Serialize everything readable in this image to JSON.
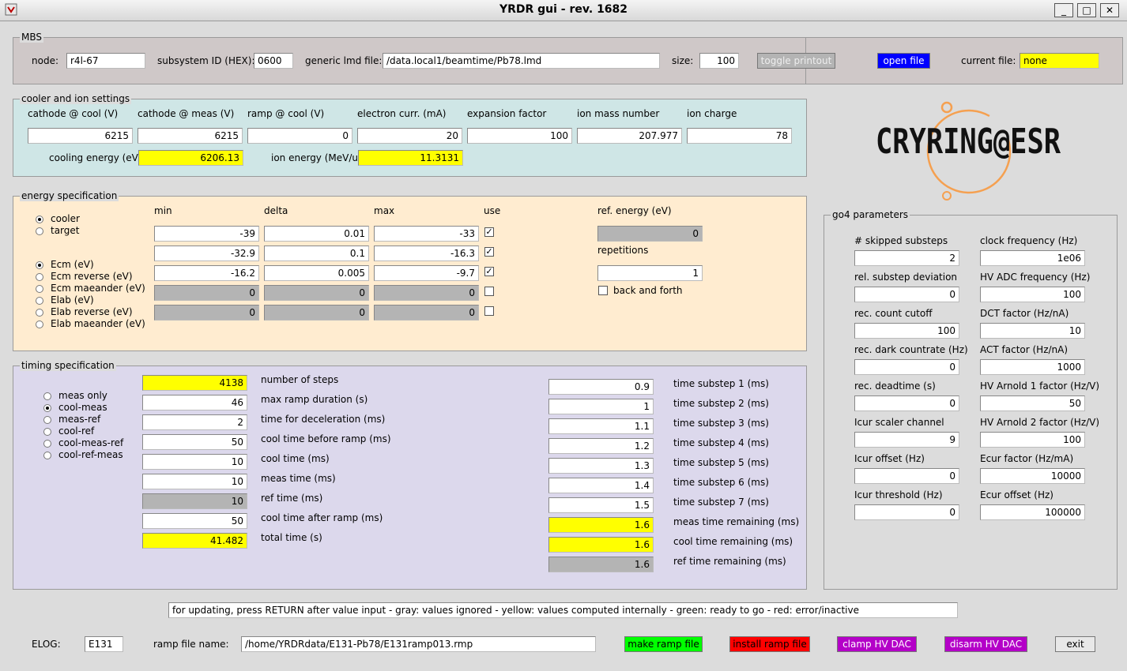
{
  "window": {
    "title": "YRDR gui - rev. 1682",
    "minimize": "_",
    "maximize": "□",
    "close": "✕"
  },
  "mbs": {
    "title": "MBS",
    "node_label": "node:",
    "node": "r4l-67",
    "subsystem_label": "subsystem ID (HEX):",
    "subsystem": "0600",
    "lmd_label": "generic lmd file:",
    "lmd": "/data.local1/beamtime/Pb78.lmd",
    "size_label": "size:",
    "size": "100",
    "toggle_printout": "toggle printout",
    "open_file": "open file",
    "current_file_label": "current file:",
    "current_file": "none"
  },
  "cooler": {
    "title": "cooler and ion  settings",
    "headers": [
      "cathode @ cool (V)",
      "cathode @ meas (V)",
      "ramp @ cool (V)",
      "electron curr. (mA)",
      "expansion factor",
      "ion mass number",
      "ion charge"
    ],
    "values": [
      "6215",
      "6215",
      "0",
      "20",
      "100",
      "207.977",
      "78"
    ],
    "cooling_energy_label": "cooling energy (eV):",
    "cooling_energy": "6206.13",
    "ion_energy_label": "ion energy (MeV/u):",
    "ion_energy": "11.3131"
  },
  "logo": {
    "text": "CRYRING@ESR"
  },
  "energy": {
    "title": "energy specification",
    "col_min": "min",
    "col_delta": "delta",
    "col_max": "max",
    "col_use": "use",
    "mode_radios": [
      {
        "label": "cooler",
        "checked": true
      },
      {
        "label": "target",
        "checked": false
      }
    ],
    "type_radios": [
      {
        "label": "Ecm (eV)",
        "checked": true
      },
      {
        "label": "Ecm reverse (eV)",
        "checked": false
      },
      {
        "label": "Ecm maeander (eV)",
        "checked": false
      },
      {
        "label": "Elab (eV)",
        "checked": false
      },
      {
        "label": "Elab reverse (eV)",
        "checked": false
      },
      {
        "label": "Elab maeander (eV)",
        "checked": false
      }
    ],
    "rows": [
      {
        "min": "-39",
        "delta": "0.01",
        "max": "-33",
        "use": true,
        "disabled": false
      },
      {
        "min": "-32.9",
        "delta": "0.1",
        "max": "-16.3",
        "use": true,
        "disabled": false
      },
      {
        "min": "-16.2",
        "delta": "0.005",
        "max": "-9.7",
        "use": true,
        "disabled": false
      },
      {
        "min": "0",
        "delta": "0",
        "max": "0",
        "use": false,
        "disabled": true
      },
      {
        "min": "0",
        "delta": "0",
        "max": "0",
        "use": false,
        "disabled": true
      }
    ],
    "ref_energy_label": "ref. energy (eV)",
    "ref_energy": "0",
    "repetitions_label": "repetitions",
    "repetitions": "1",
    "back_forth_label": "back and forth"
  },
  "timing": {
    "title": "timing specification",
    "radios": [
      {
        "label": "meas only",
        "checked": false
      },
      {
        "label": "cool-meas",
        "checked": true
      },
      {
        "label": "meas-ref",
        "checked": false
      },
      {
        "label": "cool-ref",
        "checked": false
      },
      {
        "label": "cool-meas-ref",
        "checked": false
      },
      {
        "label": "cool-ref-meas",
        "checked": false
      }
    ],
    "left": [
      {
        "value": "4138",
        "label": "number of steps",
        "style": "yel"
      },
      {
        "value": "46",
        "label": "max ramp duration (s)",
        "style": ""
      },
      {
        "value": "2",
        "label": "time for deceleration (ms)",
        "style": ""
      },
      {
        "value": "50",
        "label": "cool time before ramp (ms)",
        "style": ""
      },
      {
        "value": "10",
        "label": "cool time (ms)",
        "style": ""
      },
      {
        "value": "10",
        "label": "meas time (ms)",
        "style": ""
      },
      {
        "value": "10",
        "label": "ref time (ms)",
        "style": "gry"
      },
      {
        "value": "50",
        "label": "cool time after ramp (ms)",
        "style": ""
      },
      {
        "value": "41.482",
        "label": "total time (s)",
        "style": "yel"
      }
    ],
    "right": [
      {
        "value": "0.9",
        "label": "time substep 1 (ms)",
        "style": ""
      },
      {
        "value": "1",
        "label": "time substep 2 (ms)",
        "style": ""
      },
      {
        "value": "1.1",
        "label": "time substep 3 (ms)",
        "style": ""
      },
      {
        "value": "1.2",
        "label": "time substep 4 (ms)",
        "style": ""
      },
      {
        "value": "1.3",
        "label": "time substep 5 (ms)",
        "style": ""
      },
      {
        "value": "1.4",
        "label": "time substep 6 (ms)",
        "style": ""
      },
      {
        "value": "1.5",
        "label": "time substep 7 (ms)",
        "style": ""
      },
      {
        "value": "1.6",
        "label": "meas time remaining (ms)",
        "style": "yel"
      },
      {
        "value": "1.6",
        "label": "cool time remaining (ms)",
        "style": "yel"
      },
      {
        "value": "1.6",
        "label": "ref time remaining (ms)",
        "style": "gry"
      }
    ]
  },
  "go4": {
    "title": "go4 parameters",
    "left": [
      {
        "label": "# skipped substeps",
        "value": "2"
      },
      {
        "label": "rel. substep deviation",
        "value": "0"
      },
      {
        "label": "rec. count cutoff",
        "value": "100"
      },
      {
        "label": "rec. dark countrate (Hz)",
        "value": "0"
      },
      {
        "label": "rec. deadtime (s)",
        "value": "0"
      },
      {
        "label": "Icur scaler channel",
        "value": "9"
      },
      {
        "label": "Icur offset (Hz)",
        "value": "0"
      },
      {
        "label": "Icur threshold (Hz)",
        "value": "0"
      }
    ],
    "right": [
      {
        "label": "clock frequency (Hz)",
        "value": "1e06"
      },
      {
        "label": "HV ADC frequency (Hz)",
        "value": "100"
      },
      {
        "label": "DCT factor (Hz/nA)",
        "value": "10"
      },
      {
        "label": "ACT factor (Hz/nA)",
        "value": "1000"
      },
      {
        "label": "HV Arnold 1 factor (Hz/V)",
        "value": "50"
      },
      {
        "label": "HV Arnold 2 factor (Hz/V)",
        "value": "100"
      },
      {
        "label": "Ecur factor (Hz/mA)",
        "value": "10000"
      },
      {
        "label": "Ecur offset (Hz)",
        "value": "100000"
      }
    ]
  },
  "status": {
    "text": "for updating, press RETURN after value input   -   gray: values ignored   -   yellow: values computed internally   -   green: ready to go   -   red: error/inactive"
  },
  "bottom": {
    "elog_label": "ELOG:",
    "elog": "E131",
    "ramp_label": "ramp file name:",
    "ramp": "/home/YRDRdata/E131-Pb78/E131ramp013.rmp",
    "make_ramp": "make ramp file",
    "install_ramp": "install ramp file",
    "clamp": "clamp HV DAC",
    "disarm": "disarm HV DAC",
    "exit": "exit"
  },
  "colors": {
    "green": "#00ff00",
    "red": "#ff0000",
    "purple": "#b400c8",
    "blue": "#0000ff",
    "yellow": "#ffff00",
    "cooler_bg": "#cfe6e6",
    "energy_bg": "#ffecd0",
    "timing_bg": "#dcd8ec",
    "mbs_bg": "#cfc8c8",
    "logo_orange": "#f5a050"
  }
}
